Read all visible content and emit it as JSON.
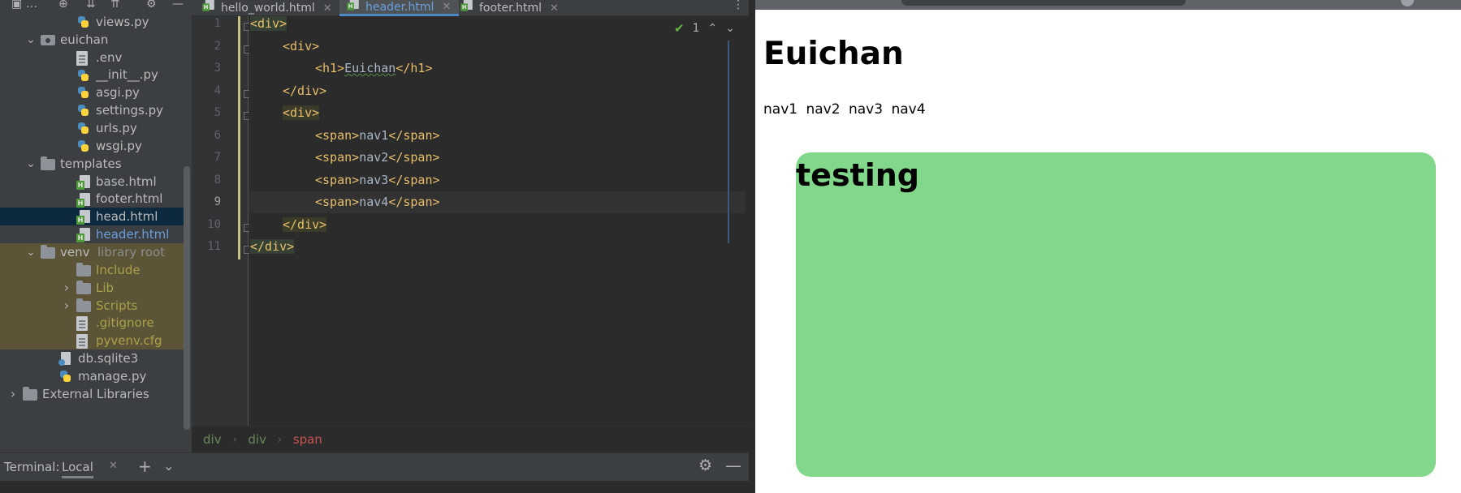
{
  "project_tree": [
    {
      "label": "views.py",
      "type": "py",
      "indent": 3,
      "style": "normal"
    },
    {
      "label": "euichan",
      "type": "pkg",
      "indent": 1,
      "expanded": true,
      "style": "normal"
    },
    {
      "label": ".env",
      "type": "file",
      "indent": 3,
      "style": "normal"
    },
    {
      "label": "__init__.py",
      "type": "py",
      "indent": 3,
      "style": "normal"
    },
    {
      "label": "asgi.py",
      "type": "py",
      "indent": 3,
      "style": "normal"
    },
    {
      "label": "settings.py",
      "type": "py",
      "indent": 3,
      "style": "normal"
    },
    {
      "label": "urls.py",
      "type": "py",
      "indent": 3,
      "style": "normal"
    },
    {
      "label": "wsgi.py",
      "type": "py",
      "indent": 3,
      "style": "normal"
    },
    {
      "label": "templates",
      "type": "folder",
      "indent": 1,
      "expanded": true,
      "style": "normal"
    },
    {
      "label": "base.html",
      "type": "html",
      "indent": 3,
      "style": "normal"
    },
    {
      "label": "footer.html",
      "type": "html",
      "indent": 3,
      "style": "normal"
    },
    {
      "label": "head.html",
      "type": "html",
      "indent": 3,
      "style": "selected"
    },
    {
      "label": "header.html",
      "type": "html",
      "indent": 3,
      "style": "blue"
    },
    {
      "label": "venv",
      "suffix": "library root",
      "type": "folder",
      "indent": 1,
      "expanded": true,
      "style": "venv"
    },
    {
      "label": "Include",
      "type": "folder",
      "indent": 3,
      "style": "venv-olive"
    },
    {
      "label": "Lib",
      "type": "folder",
      "indent": 3,
      "collapsed": true,
      "style": "venv-olive"
    },
    {
      "label": "Scripts",
      "type": "folder",
      "indent": 3,
      "collapsed": true,
      "style": "venv-olive"
    },
    {
      "label": ".gitignore",
      "type": "file",
      "indent": 3,
      "style": "venv-olive"
    },
    {
      "label": "pyvenv.cfg",
      "type": "file",
      "indent": 3,
      "style": "venv-olive"
    },
    {
      "label": "db.sqlite3",
      "type": "db",
      "indent": 2,
      "style": "normal"
    },
    {
      "label": "manage.py",
      "type": "py",
      "indent": 2,
      "style": "normal"
    },
    {
      "label": "External Libraries",
      "type": "folder",
      "indent": 0,
      "collapsed": true,
      "style": "normal"
    }
  ],
  "tabs": [
    {
      "label": "hello_world.html",
      "active": false
    },
    {
      "label": "header.html",
      "active": true
    },
    {
      "label": "footer.html",
      "active": false
    }
  ],
  "editor": {
    "inspection_count": "1",
    "current_line": 9,
    "lines": [
      {
        "n": "1",
        "indent": 0,
        "open": "<div>",
        "text": "",
        "close": ""
      },
      {
        "n": "2",
        "indent": 1,
        "open": "<div>",
        "text": "",
        "close": ""
      },
      {
        "n": "3",
        "indent": 2,
        "open": "<h1>",
        "text": "Euichan",
        "close": "</h1>"
      },
      {
        "n": "4",
        "indent": 1,
        "open": "</div>",
        "text": "",
        "close": ""
      },
      {
        "n": "5",
        "indent": 1,
        "open": "<div>",
        "text": "",
        "close": ""
      },
      {
        "n": "6",
        "indent": 2,
        "open": "<span>",
        "text": "nav1",
        "close": "</span>"
      },
      {
        "n": "7",
        "indent": 2,
        "open": "<span>",
        "text": "nav2",
        "close": "</span>"
      },
      {
        "n": "8",
        "indent": 2,
        "open": "<span>",
        "text": "nav3",
        "close": "</span>"
      },
      {
        "n": "9",
        "indent": 2,
        "open": "<span>",
        "text": "nav4",
        "close": "</span>"
      },
      {
        "n": "10",
        "indent": 1,
        "open": "</div>",
        "text": "",
        "close": ""
      },
      {
        "n": "11",
        "indent": 0,
        "open": "</div>",
        "text": "",
        "close": ""
      }
    ]
  },
  "breadcrumb": [
    "div",
    "div",
    "span"
  ],
  "terminal": {
    "title": "Terminal:",
    "tab": "Local"
  },
  "preview": {
    "heading": "Euichan",
    "nav": [
      "nav1",
      "nav2",
      "nav3",
      "nav4"
    ],
    "box_title": "testing"
  },
  "icons": {
    "tab_close": "close-icon",
    "expand": "chevron-down-icon",
    "collapse": "chevron-right-icon",
    "settings": "gear-icon"
  },
  "colors": {
    "sidebar_bg": "#3c3f41",
    "editor_bg": "#2b2b2b",
    "tag": "#e8bf6a",
    "text": "#a9b7c6",
    "selection": "#0d293e",
    "green_box": "#81d88a"
  }
}
